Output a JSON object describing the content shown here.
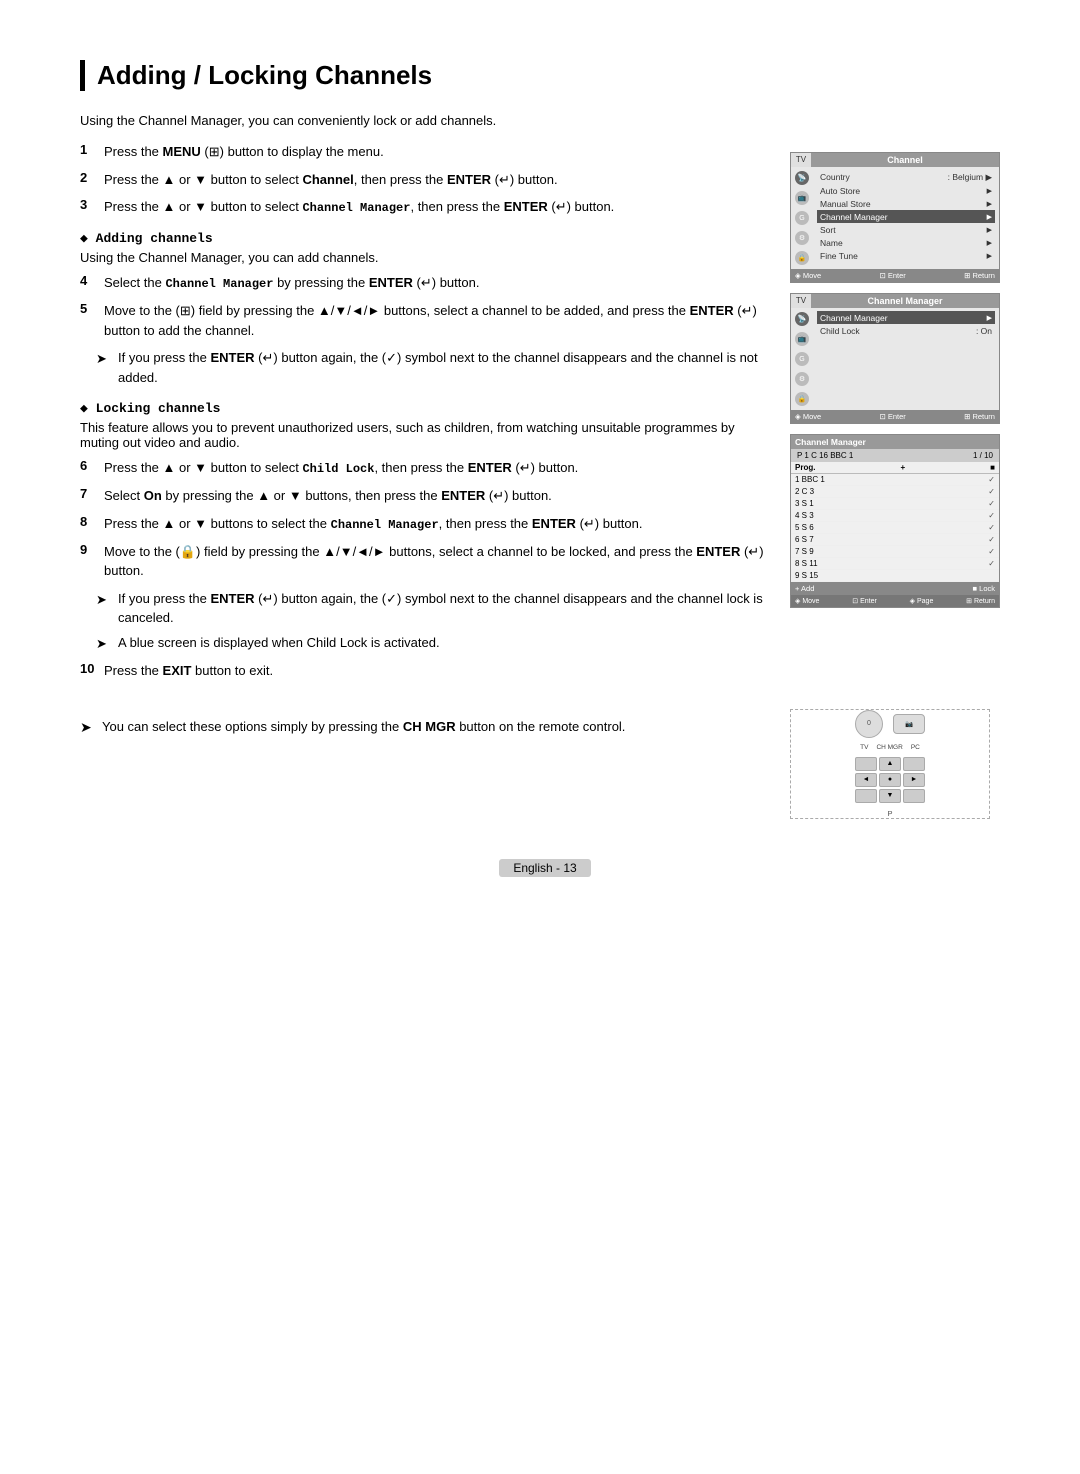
{
  "page": {
    "title": "Adding / Locking Channels",
    "intro": "Using the Channel Manager, you can conveniently lock or add channels.",
    "footer_label": "English - 13"
  },
  "steps": [
    {
      "num": "1",
      "text": "Press the <b>MENU</b> (<span class='menu-icon'>⊞</span>) button to display the menu."
    },
    {
      "num": "2",
      "text": "Press the ▲ or ▼ button to select <b>Channel</b>, then press the <b>ENTER</b> (<span>↵</span>) button."
    },
    {
      "num": "3",
      "text": "Press the ▲ or ▼ button to select <code>Channel Manager</code>, then press the <b>ENTER</b> (<span>↵</span>) button."
    }
  ],
  "adding_channels": {
    "title": "Adding channels",
    "desc": "Using the Channel Manager, you can add channels.",
    "steps": [
      {
        "num": "4",
        "text": "Select the <code>Channel Manager</code> by pressing the <b>ENTER</b> (<span>↵</span>) button."
      },
      {
        "num": "5",
        "text": "Move to the (<span>⊞</span>) field by pressing the ▲/▼/◄/► buttons, select a channel to be added, and press the <b>ENTER</b> (<span>↵</span>) button to add the channel."
      }
    ],
    "note": "If you press the <b>ENTER</b> (<span>↵</span>) button again, the (✓) symbol next to the channel disappears and the channel is not added."
  },
  "locking_channels": {
    "title": "Locking channels",
    "desc": "This feature allows you to prevent unauthorized users, such as children, from watching unsuitable programmes by muting out video and audio.",
    "steps": [
      {
        "num": "6",
        "text": "Press the ▲ or ▼ button to select <code>Child Lock</code>, then press the <b>ENTER</b> (<span>↵</span>) button."
      },
      {
        "num": "7",
        "text": "Select <b>On</b> by pressing the ▲ or ▼ buttons, then press the <b>ENTER</b> (<span>↵</span>) button."
      },
      {
        "num": "8",
        "text": "Press the ▲ or ▼ buttons to select the <code>Channel Manager</code>, then press the <b>ENTER</b> (<span>↵</span>) button."
      },
      {
        "num": "9",
        "text": "Move to the (🔒) field by pressing the ▲/▼/◄/► buttons, select a channel to be locked, and press the <b>ENTER</b> (<span>↵</span>) button."
      }
    ],
    "notes": [
      "If you press the <b>ENTER</b> (<span>↵</span>) button again, the (✓) symbol next to the channel disappears and the channel lock is canceled.",
      "A blue screen is displayed when Child Lock is activated."
    ]
  },
  "step10": {
    "num": "10",
    "text": "Press the <b>EXIT</b> button to exit."
  },
  "footer_note": "You can select these options simply by pressing the <b>CH MGR</b> button on the remote control.",
  "screen1": {
    "header": "Channel",
    "items": [
      {
        "label": "Country",
        "value": ": Belgium",
        "arrow": true
      },
      {
        "label": "Auto Store",
        "arrow": true
      },
      {
        "label": "Manual Store",
        "arrow": true
      },
      {
        "label": "Channel Manager",
        "highlighted": true,
        "arrow": true
      },
      {
        "label": "Sort",
        "arrow": true
      },
      {
        "label": "Name",
        "arrow": true
      },
      {
        "label": "Fine Tune",
        "arrow": true
      }
    ],
    "footer": [
      "◈ Move",
      "⊡ Enter",
      "⊞⊞ Return"
    ]
  },
  "screen2": {
    "header": "Channel Manager",
    "items": [
      {
        "label": "Channel Manager",
        "arrow": true
      },
      {
        "label": "Child Lock",
        "value": ": On",
        "arrow": false
      }
    ],
    "footer": [
      "◈ Move",
      "⊡ Enter",
      "⊞⊞ Return"
    ]
  },
  "screen3": {
    "header": "Channel Manager",
    "info": "P 1  C 16  BBC 1",
    "page": "1 / 10",
    "cols": [
      "Prog.",
      "+",
      "■"
    ],
    "rows": [
      {
        "num": "1",
        "name": "BBC 1",
        "check": true
      },
      {
        "num": "2",
        "name": "C 3",
        "check": true
      },
      {
        "num": "3",
        "name": "S 1",
        "check": true
      },
      {
        "num": "4",
        "name": "S 3",
        "check": true
      },
      {
        "num": "5",
        "name": "S 6",
        "check": true
      },
      {
        "num": "6",
        "name": "S 7",
        "check": true
      },
      {
        "num": "7",
        "name": "S 9",
        "check": true
      },
      {
        "num": "8",
        "name": "S 11",
        "check": true
      },
      {
        "num": "9",
        "name": "S 15",
        "check": false
      }
    ],
    "footer_actions": [
      "+ Add",
      "■ Lock"
    ],
    "footer_nav": [
      "◈ Move",
      "⊡ Enter",
      "◈ Page",
      "⊞⊞ Return"
    ]
  }
}
